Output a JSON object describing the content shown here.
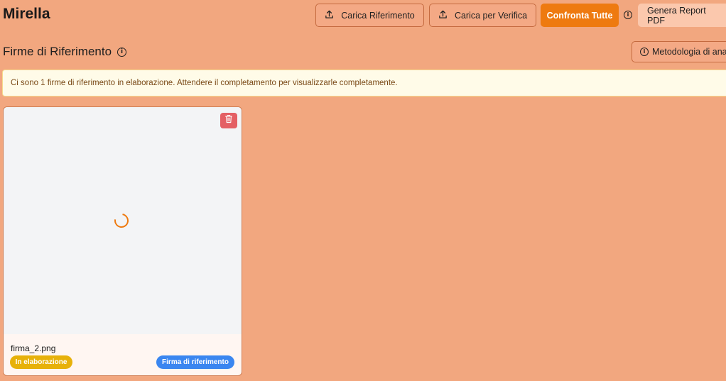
{
  "header": {
    "title": "Mirella",
    "upload_reference_label": "Carica Riferimento",
    "upload_verify_label": "Carica per Verifica",
    "compare_all_label": "Confronta Tutte",
    "info_glyph": "i",
    "report_label": "Genera Report PDF"
  },
  "section": {
    "title": "Firme di Riferimento",
    "info_glyph": "i",
    "methodology_label": "Metodologia di analisi"
  },
  "notice": {
    "text": "Ci sono 1 firme di riferimento in elaborazione. Attendere il completamento per visualizzarle completamente."
  },
  "cards": [
    {
      "filename": "firma_2.png",
      "status_badge": "In elaborazione",
      "type_badge": "Firma di riferimento",
      "icons": {
        "delete": "trash-icon",
        "loading": "spinner-icon"
      }
    }
  ],
  "colors": {
    "background": "#f2a77f",
    "primary": "#ee7a10",
    "danger": "#e45f64",
    "status_processing": "#e7b10a",
    "type_reference": "#3a86f0"
  }
}
